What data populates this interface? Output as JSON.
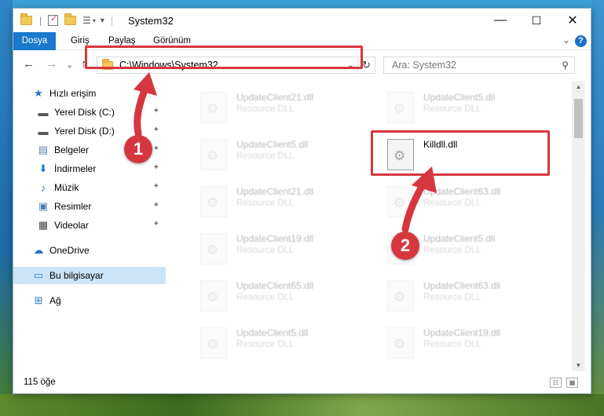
{
  "window": {
    "title": "System32",
    "minimize": "—",
    "maximize": "☐",
    "close": "✕"
  },
  "ribbon": {
    "tabs": [
      "Dosya",
      "Giriş",
      "Paylaş",
      "Görünüm"
    ],
    "help": "?",
    "collapse": "⌄"
  },
  "navigation": {
    "back": "←",
    "forward": "→",
    "recent": "⌄",
    "up": "↑",
    "address": "C:\\Windows\\System32",
    "address_dropdown": "⌄",
    "refresh": "↻",
    "search_placeholder": "Ara: System32",
    "search_icon": "⚲"
  },
  "sidebar": {
    "items": [
      {
        "label": "Hızlı erişim",
        "icon": "star-icon",
        "glyph": "★",
        "color": "#1f73c8"
      },
      {
        "label": "Yerel Disk (C:)",
        "icon": "drive-icon",
        "glyph": "▬",
        "color": "#555555",
        "pinned": true
      },
      {
        "label": "Yerel Disk (D:)",
        "icon": "drive-icon",
        "glyph": "▬",
        "color": "#555555",
        "pinned": true
      },
      {
        "label": "Belgeler",
        "icon": "documents-icon",
        "glyph": "▤",
        "color": "#5b7fa8",
        "pinned": true
      },
      {
        "label": "İndirmeler",
        "icon": "download-icon",
        "glyph": "⬇",
        "color": "#1f73c8",
        "pinned": true
      },
      {
        "label": "Müzik",
        "icon": "music-icon",
        "glyph": "♪",
        "color": "#1f73c8",
        "pinned": true
      },
      {
        "label": "Resimler",
        "icon": "pictures-icon",
        "glyph": "▣",
        "color": "#4a7fb5",
        "pinned": true
      },
      {
        "label": "Videolar",
        "icon": "videos-icon",
        "glyph": "▦",
        "color": "#444444",
        "pinned": true
      },
      {
        "label": "OneDrive",
        "icon": "cloud-icon",
        "glyph": "☁",
        "color": "#1f73c8"
      },
      {
        "label": "Bu bilgisayar",
        "icon": "computer-icon",
        "glyph": "▭",
        "color": "#2b7bd0",
        "selected": true
      },
      {
        "label": "Ağ",
        "icon": "network-icon",
        "glyph": "⊞",
        "color": "#2b7bd0"
      }
    ],
    "pin_glyph": "📌"
  },
  "files": [
    {
      "name": "UpdateClient21.dll",
      "desc": "Resource DLL",
      "blurred": true
    },
    {
      "name": "UpdateClient5.dll",
      "desc": "Resource DLL",
      "blurred": true
    },
    {
      "name": "UpdateClient5.dll",
      "desc": "Resource DLL",
      "blurred": true
    },
    {
      "name": "Killdll.dll",
      "desc": "",
      "blurred": false
    },
    {
      "name": "UpdateClient21.dll",
      "desc": "Resource DLL",
      "blurred": true
    },
    {
      "name": "UpdateClient63.dll",
      "desc": "Resource DLL",
      "blurred": true
    },
    {
      "name": "UpdateClient19.dll",
      "desc": "Resource DLL",
      "blurred": true
    },
    {
      "name": "UpdateClient5.dll",
      "desc": "Resource DLL",
      "blurred": true
    },
    {
      "name": "UpdateClient65.dll",
      "desc": "Resource DLL",
      "blurred": true
    },
    {
      "name": "UpdateClient63.dll",
      "desc": "Resource DLL",
      "blurred": true
    },
    {
      "name": "UpdateClient5.dll",
      "desc": "Resource DLL",
      "blurred": true
    },
    {
      "name": "UpdateClient19.dll",
      "desc": "Resource DLL",
      "blurred": true
    }
  ],
  "status": {
    "count": "115 öğe"
  },
  "callouts": [
    "1",
    "2"
  ],
  "colors": {
    "highlight": "#d6373f",
    "file_tab": "#1979ca",
    "selected_nav": "#cce4f7"
  }
}
